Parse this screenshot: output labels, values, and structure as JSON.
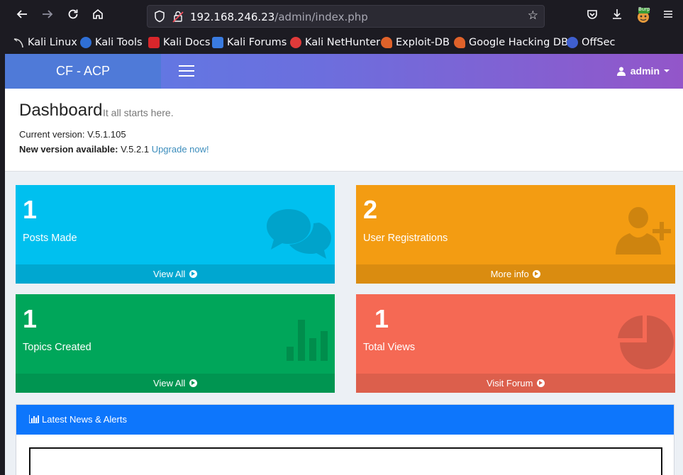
{
  "browser": {
    "url_host": "192.168.246.23",
    "url_path": "/admin/index.php",
    "bookmarks": [
      "Kali Linux",
      "Kali Tools",
      "Kali Docs",
      "Kali Forums",
      "Kali NetHunter",
      "Exploit-DB",
      "Google Hacking DB",
      "OffSec"
    ],
    "extension_badge": "Burp"
  },
  "app": {
    "brand": "CF - ACP",
    "user": "admin"
  },
  "header": {
    "title": "Dashboard",
    "subtitle": "It all starts here.",
    "current_version": "Current version: V.5.1.105",
    "new_version_label": "New version available:",
    "new_version_value": " V.5.2.1 ",
    "upgrade_link": "Upgrade now!"
  },
  "stats": [
    {
      "value": "1",
      "label": "Posts Made",
      "link": "View All",
      "color": "#00c0ef",
      "footer_color": "#00a7d0",
      "icon": "comments-icon"
    },
    {
      "value": "2",
      "label": "User Registrations",
      "link": "More info",
      "color": "#f39c12",
      "footer_color": "#da8c10",
      "icon": "user-plus-icon"
    },
    {
      "value": "1",
      "label": "Topics Created",
      "link": "View All",
      "color": "#00a65a",
      "footer_color": "#009551",
      "icon": "bar-chart-icon"
    },
    {
      "value": "1",
      "label": "Total Views",
      "link": "Visit Forum",
      "color": "#f56954",
      "footer_color": "#dc5f4c",
      "icon": "pie-chart-icon"
    }
  ],
  "news": {
    "title": "Latest News & Alerts",
    "color": "#0d76fc"
  }
}
